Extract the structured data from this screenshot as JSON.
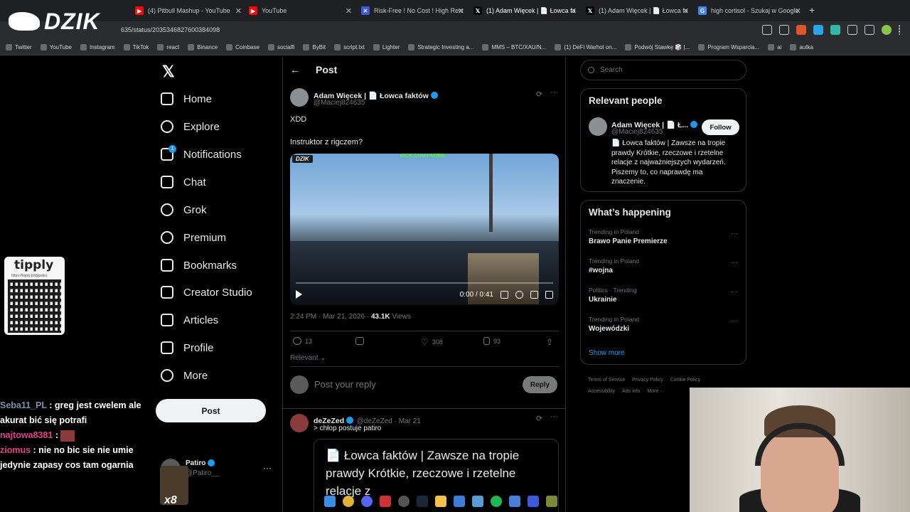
{
  "browser": {
    "tabs": [
      {
        "label": "(4) Pitbull Mashup - YouTube",
        "icon": "youtube-icon",
        "color": "#ff0000"
      },
      {
        "label": "YouTube",
        "icon": "youtube-icon",
        "color": "#ff0000"
      },
      {
        "label": "Risk-Free ! No Cost ! High Rew",
        "icon": "x-blue-icon",
        "color": "#3b5bdb"
      },
      {
        "label": "(1) Adam Więcek | 📄 Łowca fa",
        "icon": "x-icon",
        "color": "#000000"
      },
      {
        "label": "(1) Adam Więcek | 📄 Łowca fa",
        "icon": "x-icon",
        "color": "#000000"
      },
      {
        "label": "high cortisol - Szukaj w Google",
        "icon": "google-icon",
        "color": "#4285f4"
      }
    ],
    "new_tab": "+",
    "url": "635/status/2035346827600384098",
    "bookmarks": [
      {
        "label": "Twitter",
        "icon": "x-icon"
      },
      {
        "label": "YouTube",
        "icon": "youtube-icon"
      },
      {
        "label": "Instagram",
        "icon": "instagram-icon"
      },
      {
        "label": "TikTok",
        "icon": "tiktok-icon"
      },
      {
        "label": "react",
        "icon": "tiktok-icon"
      },
      {
        "label": "Binance",
        "icon": "binance-icon"
      },
      {
        "label": "Coinbase",
        "icon": "coinbase-icon"
      },
      {
        "label": "socialfi",
        "icon": "folder-icon"
      },
      {
        "label": "ByBit",
        "icon": "bybit-icon"
      },
      {
        "label": "script.txt",
        "icon": "github-icon"
      },
      {
        "label": "Lighter",
        "icon": "lighter-icon"
      },
      {
        "label": "Strategic Investing a...",
        "icon": "loader-icon"
      },
      {
        "label": "MMS – BTC/XAU/N...",
        "icon": "globe-icon"
      },
      {
        "label": "(1) DeFi Warhol on...",
        "icon": "x-icon"
      },
      {
        "label": "Podwój Stawkę 🎲 |...",
        "icon": "discord-icon"
      },
      {
        "label": "Program Wsparcia...",
        "icon": "bookmark-icon"
      },
      {
        "label": "ai",
        "icon": "folder-icon"
      },
      {
        "label": "autka",
        "icon": "folder-icon"
      }
    ]
  },
  "overlay": {
    "brand": "DZIK",
    "tipply_name": "tipply",
    "tipply_url": "https://tipply.pl/@patiro",
    "chat": [
      {
        "user": "Seba11_PL",
        "sep": " : ",
        "msg": "greg jest cwelem ale akurat bić się potrafi"
      },
      {
        "user": "najtowa8381",
        "sep": " : ",
        "msg": ""
      },
      {
        "user": "ziomus",
        "sep": " : ",
        "msg": "nie no bic sie nie umie jedynie zapasy cos tam ogarnia"
      }
    ],
    "multiplier": "x8"
  },
  "nav": {
    "items": [
      {
        "label": "Home",
        "icon": "home-icon"
      },
      {
        "label": "Explore",
        "icon": "search-icon"
      },
      {
        "label": "Notifications",
        "icon": "bell-icon",
        "badge": "1"
      },
      {
        "label": "Chat",
        "icon": "mail-icon"
      },
      {
        "label": "Grok",
        "icon": "grok-icon"
      },
      {
        "label": "Premium",
        "icon": "premium-icon"
      },
      {
        "label": "Bookmarks",
        "icon": "bookmark-icon"
      },
      {
        "label": "Creator Studio",
        "icon": "rocket-icon"
      },
      {
        "label": "Articles",
        "icon": "articles-icon"
      },
      {
        "label": "Profile",
        "icon": "person-icon"
      },
      {
        "label": "More",
        "icon": "more-icon"
      }
    ],
    "post_button": "Post",
    "account": {
      "name": "Patiro",
      "handle": "@Patiro__",
      "more": "···"
    }
  },
  "post": {
    "header": "Post",
    "author": {
      "name": "Adam Więcek | 📄 Łowca faktów",
      "handle": "@Maciej824635"
    },
    "text1": "XDD",
    "text2": "Instruktor z rigczem?",
    "video": {
      "badge": "DZIK",
      "kick": "KICK.COM/PATIRO",
      "time": "0:00 / 0:41",
      "progress": 0.0
    },
    "time": "2:24 PM · Mar 21, 2026 · ",
    "views_count": "43.1K",
    "views_label": " Views",
    "stats": {
      "replies": "13",
      "reposts": "",
      "likes": "308",
      "bookmarks": "93"
    },
    "sort": "Relevant",
    "reply_placeholder": "Post your reply",
    "reply_button": "Reply"
  },
  "reply": {
    "name": "deZeZed",
    "handle": "@deZeZed · Mar 21",
    "text": "> chłop postuje patiro",
    "quote": "📄 Łowca faktów | Zawsze na tropie prawdy Krótkie, rzeczowe i rzetelne relacje z"
  },
  "sidebar": {
    "search_placeholder": "Search",
    "relevant_title": "Relevant people",
    "person": {
      "name": "Adam Więcek | 📄 Ł...",
      "handle": "@Maciej824635",
      "follow": "Follow",
      "bio": "📄 Łowca faktów | Zawsze na tropie prawdy Krótkie, rzeczowe i rzetelne relacje z najważniejszych wydarzeń. Piszemy to, co naprawdę ma znaczenie."
    },
    "happening_title": "What’s happening",
    "trends": [
      {
        "context": "Trending in Poland",
        "title": "Brawo Panie Premierze"
      },
      {
        "context": "Trending in Poland",
        "title": "#wojna"
      },
      {
        "context": "Politics · Trending",
        "title": "Ukrainie"
      },
      {
        "context": "Trending in Poland",
        "title": "Wojewódzki"
      }
    ],
    "show_more": "Show more",
    "footer": [
      "Terms of Service",
      "Privacy Policy",
      "Cookie Policy",
      "Accessibility",
      "Ads info",
      "More ···"
    ]
  },
  "colors": {
    "accent": "#1d9bf0",
    "bg": "#000000",
    "border": "#2f3336",
    "muted": "#71767b"
  }
}
